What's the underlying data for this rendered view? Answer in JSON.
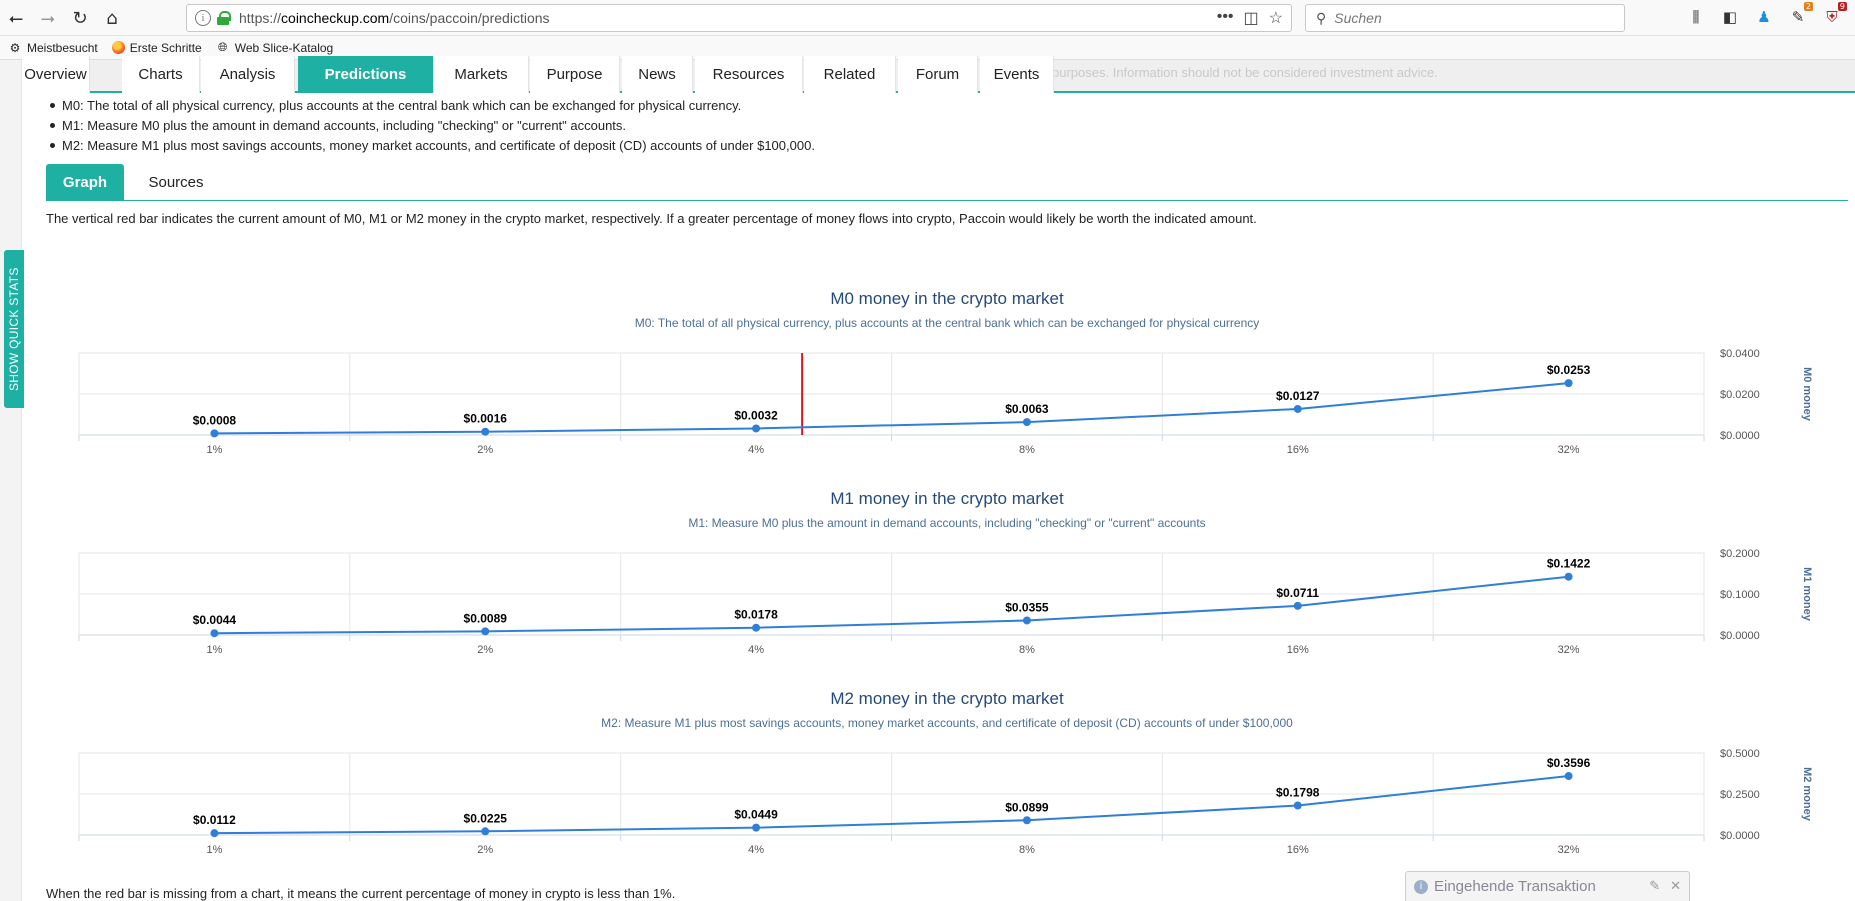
{
  "browser": {
    "url_prefix": "https://",
    "url_domain": "coincheckup.com",
    "url_path": "/coins/paccoin/predictions",
    "search_placeholder": "Suchen",
    "url_actions": [
      "•••",
      "◫",
      "☆"
    ],
    "badges": {
      "ext1": "2",
      "ext2": "9"
    }
  },
  "bookmarks": [
    {
      "label": "Meistbesucht",
      "icon": "gear-icon"
    },
    {
      "label": "Erste Schritte",
      "icon": "firefox-icon"
    },
    {
      "label": "Web Slice-Katalog",
      "icon": "globe-icon"
    }
  ],
  "nav": {
    "disclaimer": "purposes. Information should not be considered investment advice.",
    "tabs": [
      "Overview",
      "Charts",
      "Analysis",
      "Predictions",
      "Markets",
      "Purpose",
      "News",
      "Resources",
      "Related",
      "Forum",
      "Events"
    ],
    "active": "Predictions"
  },
  "quick_stats_label": "SHOW QUICK STATS",
  "definitions": [
    "M0: The total of all physical currency, plus accounts at the central bank which can be exchanged for physical currency.",
    "M1: Measure M0 plus the amount in demand accounts, including \"checking\" or \"current\" accounts.",
    "M2: Measure M1 plus most savings accounts, money market accounts, and certificate of deposit (CD) accounts of under $100,000."
  ],
  "sub_tabs": [
    "Graph",
    "Sources"
  ],
  "intro": "The vertical red bar indicates the current amount of M0, M1 or M2 money in the crypto market, respectively. If a greater percentage of money flows into crypto, Paccoin would likely be worth the indicated amount.",
  "footer_note": "When the red bar is missing from a chart, it means the current percentage of money in crypto is less than 1%.",
  "notification": {
    "label": "Eingehende Transaktion",
    "controls": [
      "✎",
      "✕"
    ]
  },
  "colors": {
    "accent": "#1fb0a4",
    "line": "#2f7ed8",
    "marker_bar": "#e0141e",
    "title": "#254b7c"
  },
  "chart_data": [
    {
      "type": "line",
      "title": "M0 money in the crypto market",
      "subtitle": "M0: The total of all physical currency, plus accounts at the central bank which can be exchanged for physical currency",
      "ylabel": "M0 money",
      "categories": [
        "1%",
        "2%",
        "4%",
        "8%",
        "16%",
        "32%"
      ],
      "values": [
        0.0008,
        0.0016,
        0.0032,
        0.0063,
        0.0127,
        0.0253
      ],
      "labels": [
        "$0.0008",
        "$0.0016",
        "$0.0032",
        "$0.0063",
        "$0.0127",
        "$0.0253"
      ],
      "yticks": [
        "$0.0000",
        "$0.0200",
        "$0.0400"
      ],
      "ylim": [
        0,
        0.04
      ],
      "red_bar_position": 2.67
    },
    {
      "type": "line",
      "title": "M1 money in the crypto market",
      "subtitle": "M1: Measure M0 plus the amount in demand accounts, including \"checking\" or \"current\" accounts",
      "ylabel": "M1 money",
      "categories": [
        "1%",
        "2%",
        "4%",
        "8%",
        "16%",
        "32%"
      ],
      "values": [
        0.0044,
        0.0089,
        0.0178,
        0.0355,
        0.0711,
        0.1422
      ],
      "labels": [
        "$0.0044",
        "$0.0089",
        "$0.0178",
        "$0.0355",
        "$0.0711",
        "$0.1422"
      ],
      "yticks": [
        "$0.0000",
        "$0.1000",
        "$0.2000"
      ],
      "ylim": [
        0,
        0.2
      ]
    },
    {
      "type": "line",
      "title": "M2 money in the crypto market",
      "subtitle": "M2: Measure M1 plus most savings accounts, money market accounts, and certificate of deposit (CD) accounts of under $100,000",
      "ylabel": "M2 money",
      "categories": [
        "1%",
        "2%",
        "4%",
        "8%",
        "16%",
        "32%"
      ],
      "values": [
        0.0112,
        0.0225,
        0.0449,
        0.0899,
        0.1798,
        0.3596
      ],
      "labels": [
        "$0.0112",
        "$0.0225",
        "$0.0449",
        "$0.0899",
        "$0.1798",
        "$0.3596"
      ],
      "yticks": [
        "$0.0000",
        "$0.2500",
        "$0.5000"
      ],
      "ylim": [
        0,
        0.5
      ]
    }
  ]
}
